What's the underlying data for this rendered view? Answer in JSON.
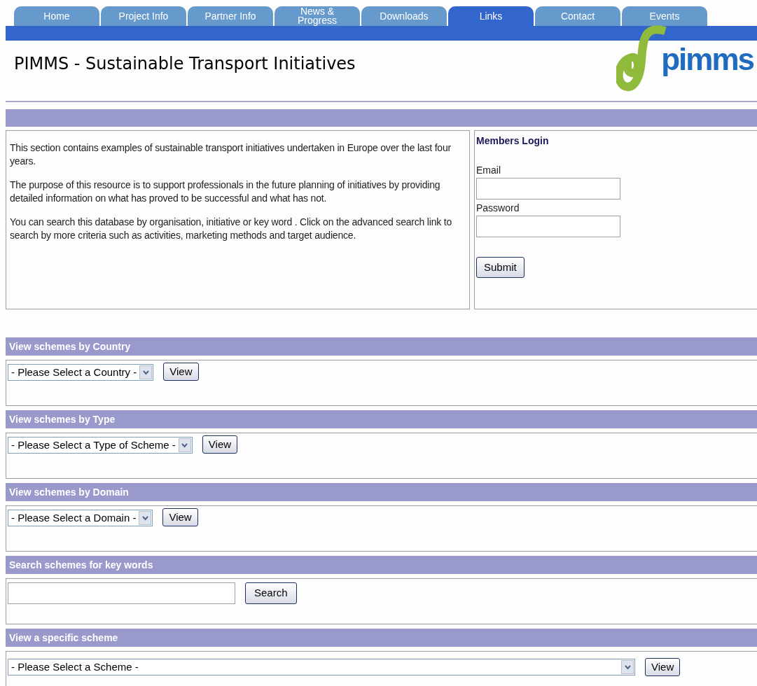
{
  "tabs": [
    {
      "label": "Home",
      "selected": false
    },
    {
      "label": "Project Info",
      "selected": false
    },
    {
      "label": "Partner Info",
      "selected": false
    },
    {
      "label": "News & Progress",
      "selected": false
    },
    {
      "label": "Downloads",
      "selected": false
    },
    {
      "label": "Links",
      "selected": true
    },
    {
      "label": "Contact",
      "selected": false
    },
    {
      "label": "Events",
      "selected": false
    }
  ],
  "page_title": "PIMMS - Sustainable Transport Initiatives",
  "logo": {
    "text": "pimms"
  },
  "intro": [
    "This section contains examples of sustainable transport initiatives undertaken in Europe over the last four years.",
    "The purpose of this resource is to support professionals in the future planning of initiatives by providing detailed information on what has proved to be successful and what has not.",
    "You can search this database by organisation, initiative or key word . Click on the advanced search link to search by more criteria such as activities, marketing methods and target audience."
  ],
  "login": {
    "title": "Members Login",
    "email_label": "Email",
    "password_label": "Password",
    "button": "Submit"
  },
  "sections": [
    {
      "kind": "select",
      "title": "View schemes by Country",
      "value": "- Please Select a Country -",
      "button": "View"
    },
    {
      "kind": "select",
      "title": "View schemes by Type",
      "value": "- Please Select a Type of Scheme -",
      "button": "View"
    },
    {
      "kind": "select",
      "title": "View schemes by Domain",
      "value": "- Please Select a Domain -",
      "button": "View"
    },
    {
      "kind": "search",
      "title": "Search schemes for key words",
      "button": "Search"
    },
    {
      "kind": "wide_select",
      "title": "View a specific scheme",
      "value": "- Please Select a Scheme -",
      "button": "View"
    }
  ]
}
